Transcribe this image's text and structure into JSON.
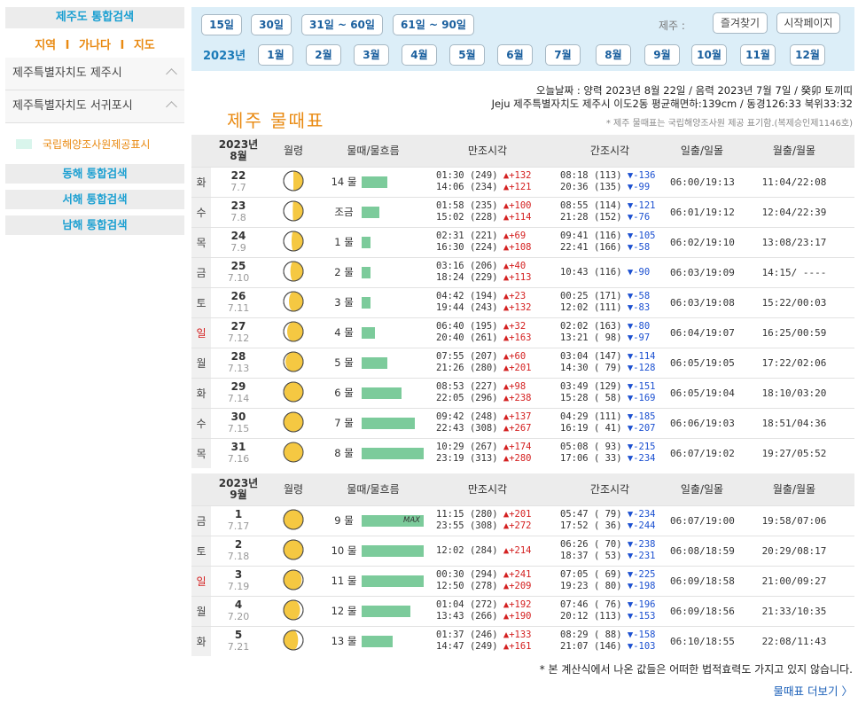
{
  "sidebar": {
    "title": "제주도 통합검색",
    "tabs": [
      "지역",
      "가나다",
      "지도"
    ],
    "tab_sep": "I",
    "regions": [
      "제주특별자치도 제주시",
      "제주특별자치도 서귀포시"
    ],
    "legend": "국립해양조사원제공표시",
    "buttons": [
      "동해 통합검색",
      "서해 통합검색",
      "남해 통합검색"
    ]
  },
  "nav": {
    "ranges": [
      "15일",
      "30일",
      "31일 ~ 60일",
      "61일 ~ 90일"
    ],
    "region_label": "제주 :",
    "favorites": "즐겨찾기",
    "home": "시작페이지",
    "year": "2023년",
    "months": [
      "1월",
      "2월",
      "3월",
      "4월",
      "5월",
      "6월",
      "7월",
      "8월",
      "9월",
      "10월",
      "11월",
      "12월"
    ]
  },
  "info": {
    "today": "오늘날짜 : 양력 2023년 8월 22일 / 음력 2023년 7월 7일 / 癸卯 토끼띠",
    "location": "Jeju 제주특별자치도 제주시 이도2동 평균해면하:139cm / 동경126:33 북위33:32",
    "title": "제주 물때표",
    "provider_note": "* 제주 물때표는 국립해양조사원 제공 표기함.(복제승인제1146호)"
  },
  "headers": {
    "moon": "월령",
    "tide": "물때/물흐름",
    "high": "만조시각",
    "low": "간조시각",
    "sun": "일출/일몰",
    "moonrise": "월출/월몰"
  },
  "months": [
    {
      "year": "2023년",
      "month": "8월",
      "rows": [
        {
          "dow": "화",
          "sun": false,
          "day": "22",
          "lunar": "7.7",
          "phase": 0.5,
          "mul": "14 물",
          "flow": 0.42,
          "max": false,
          "high": [
            {
              "t": "01:30",
              "h": "(249)",
              "d": "▲+132"
            },
            {
              "t": "14:06",
              "h": "(234)",
              "d": "▲+121"
            }
          ],
          "low": [
            {
              "t": "08:18",
              "h": "(113)",
              "d": "▼-136"
            },
            {
              "t": "20:36",
              "h": "(135)",
              "d": "▼-99"
            }
          ],
          "sun_times": "06:00/19:13",
          "moon_times": "11:04/22:08"
        },
        {
          "dow": "수",
          "sun": false,
          "day": "23",
          "lunar": "7.8",
          "phase": 0.52,
          "mul": "조금",
          "flow": 0.28,
          "max": false,
          "high": [
            {
              "t": "01:58",
              "h": "(235)",
              "d": "▲+100"
            },
            {
              "t": "15:02",
              "h": "(228)",
              "d": "▲+114"
            }
          ],
          "low": [
            {
              "t": "08:55",
              "h": "(114)",
              "d": "▼-121"
            },
            {
              "t": "21:28",
              "h": "(152)",
              "d": "▼-76"
            }
          ],
          "sun_times": "06:01/19:12",
          "moon_times": "12:04/22:39"
        },
        {
          "dow": "목",
          "sun": false,
          "day": "24",
          "lunar": "7.9",
          "phase": 0.56,
          "mul": "1 물",
          "flow": 0.14,
          "max": false,
          "high": [
            {
              "t": "02:31",
              "h": "(221)",
              "d": "▲+69"
            },
            {
              "t": "16:30",
              "h": "(224)",
              "d": "▲+108"
            }
          ],
          "low": [
            {
              "t": "09:41",
              "h": "(116)",
              "d": "▼-105"
            },
            {
              "t": "22:41",
              "h": "(166)",
              "d": "▼-58"
            }
          ],
          "sun_times": "06:02/19:10",
          "moon_times": "13:08/23:17"
        },
        {
          "dow": "금",
          "sun": false,
          "day": "25",
          "lunar": "7.10",
          "phase": 0.6,
          "mul": "2 물",
          "flow": 0.14,
          "max": false,
          "high": [
            {
              "t": "03:16",
              "h": "(206)",
              "d": "▲+40"
            },
            {
              "t": "18:24",
              "h": "(229)",
              "d": "▲+113"
            }
          ],
          "low": [
            {
              "t": "10:43",
              "h": "(116)",
              "d": "▼-90"
            }
          ],
          "sun_times": "06:03/19:09",
          "moon_times": "14:15/ ----"
        },
        {
          "dow": "토",
          "sun": false,
          "day": "26",
          "lunar": "7.11",
          "phase": 0.65,
          "mul": "3 물",
          "flow": 0.14,
          "max": false,
          "high": [
            {
              "t": "04:42",
              "h": "(194)",
              "d": "▲+23"
            },
            {
              "t": "19:44",
              "h": "(243)",
              "d": "▲+132"
            }
          ],
          "low": [
            {
              "t": "00:25",
              "h": "(171)",
              "d": "▼-58"
            },
            {
              "t": "12:02",
              "h": "(111)",
              "d": "▼-83"
            }
          ],
          "sun_times": "06:03/19:08",
          "moon_times": "15:22/00:03"
        },
        {
          "dow": "일",
          "sun": true,
          "day": "27",
          "lunar": "7.12",
          "phase": 0.72,
          "mul": "4 물",
          "flow": 0.21,
          "max": false,
          "high": [
            {
              "t": "06:40",
              "h": "(195)",
              "d": "▲+32"
            },
            {
              "t": "20:40",
              "h": "(261)",
              "d": "▲+163"
            }
          ],
          "low": [
            {
              "t": "02:02",
              "h": "(163)",
              "d": "▼-80"
            },
            {
              "t": "13:21",
              "h": "( 98)",
              "d": "▼-97"
            }
          ],
          "sun_times": "06:04/19:07",
          "moon_times": "16:25/00:59"
        },
        {
          "dow": "월",
          "sun": false,
          "day": "28",
          "lunar": "7.13",
          "phase": 0.8,
          "mul": "5 물",
          "flow": 0.42,
          "max": false,
          "high": [
            {
              "t": "07:55",
              "h": "(207)",
              "d": "▲+60"
            },
            {
              "t": "21:26",
              "h": "(280)",
              "d": "▲+201"
            }
          ],
          "low": [
            {
              "t": "03:04",
              "h": "(147)",
              "d": "▼-114"
            },
            {
              "t": "14:30",
              "h": "( 79)",
              "d": "▼-128"
            }
          ],
          "sun_times": "06:05/19:05",
          "moon_times": "17:22/02:06"
        },
        {
          "dow": "화",
          "sun": false,
          "day": "29",
          "lunar": "7.14",
          "phase": 0.88,
          "mul": "6 물",
          "flow": 0.64,
          "max": false,
          "high": [
            {
              "t": "08:53",
              "h": "(227)",
              "d": "▲+98"
            },
            {
              "t": "22:05",
              "h": "(296)",
              "d": "▲+238"
            }
          ],
          "low": [
            {
              "t": "03:49",
              "h": "(129)",
              "d": "▼-151"
            },
            {
              "t": "15:28",
              "h": "( 58)",
              "d": "▼-169"
            }
          ],
          "sun_times": "06:05/19:04",
          "moon_times": "18:10/03:20"
        },
        {
          "dow": "수",
          "sun": false,
          "day": "30",
          "lunar": "7.15",
          "phase": 0.96,
          "mul": "7 물",
          "flow": 0.85,
          "max": false,
          "high": [
            {
              "t": "09:42",
              "h": "(248)",
              "d": "▲+137"
            },
            {
              "t": "22:43",
              "h": "(308)",
              "d": "▲+267"
            }
          ],
          "low": [
            {
              "t": "04:29",
              "h": "(111)",
              "d": "▼-185"
            },
            {
              "t": "16:19",
              "h": "( 41)",
              "d": "▼-207"
            }
          ],
          "sun_times": "06:06/19:03",
          "moon_times": "18:51/04:36"
        },
        {
          "dow": "목",
          "sun": false,
          "day": "31",
          "lunar": "7.16",
          "phase": 1.0,
          "mul": "8 물",
          "flow": 1.0,
          "max": false,
          "high": [
            {
              "t": "10:29",
              "h": "(267)",
              "d": "▲+174"
            },
            {
              "t": "23:19",
              "h": "(313)",
              "d": "▲+280"
            }
          ],
          "low": [
            {
              "t": "05:08",
              "h": "( 93)",
              "d": "▼-215"
            },
            {
              "t": "17:06",
              "h": "( 33)",
              "d": "▼-234"
            }
          ],
          "sun_times": "06:07/19:02",
          "moon_times": "19:27/05:52"
        }
      ]
    },
    {
      "year": "2023년",
      "month": "9월",
      "rows": [
        {
          "dow": "금",
          "sun": false,
          "day": "1",
          "lunar": "7.17",
          "phase": 1.04,
          "mul": "9 물",
          "flow": 1.0,
          "max": true,
          "max_label": "MAX",
          "high": [
            {
              "t": "11:15",
              "h": "(280)",
              "d": "▲+201"
            },
            {
              "t": "23:55",
              "h": "(308)",
              "d": "▲+272"
            }
          ],
          "low": [
            {
              "t": "05:47",
              "h": "( 79)",
              "d": "▼-234"
            },
            {
              "t": "17:52",
              "h": "( 36)",
              "d": "▼-244"
            }
          ],
          "sun_times": "06:07/19:00",
          "moon_times": "19:58/07:06"
        },
        {
          "dow": "토",
          "sun": false,
          "day": "2",
          "lunar": "7.18",
          "phase": 1.1,
          "mul": "10 물",
          "flow": 1.0,
          "max": false,
          "high": [
            {
              "t": "12:02",
              "h": "(284)",
              "d": "▲+214"
            }
          ],
          "low": [
            {
              "t": "06:26",
              "h": "( 70)",
              "d": "▼-238"
            },
            {
              "t": "18:37",
              "h": "( 53)",
              "d": "▼-231"
            }
          ],
          "sun_times": "06:08/18:59",
          "moon_times": "20:29/08:17"
        },
        {
          "dow": "일",
          "sun": true,
          "day": "3",
          "lunar": "7.19",
          "phase": 1.18,
          "mul": "11 물",
          "flow": 1.0,
          "max": false,
          "high": [
            {
              "t": "00:30",
              "h": "(294)",
              "d": "▲+241"
            },
            {
              "t": "12:50",
              "h": "(278)",
              "d": "▲+209"
            }
          ],
          "low": [
            {
              "t": "07:05",
              "h": "( 69)",
              "d": "▼-225"
            },
            {
              "t": "19:23",
              "h": "( 80)",
              "d": "▼-198"
            }
          ],
          "sun_times": "06:09/18:58",
          "moon_times": "21:00/09:27"
        },
        {
          "dow": "월",
          "sun": false,
          "day": "4",
          "lunar": "7.20",
          "phase": 1.26,
          "mul": "12 물",
          "flow": 0.78,
          "max": false,
          "high": [
            {
              "t": "01:04",
              "h": "(272)",
              "d": "▲+192"
            },
            {
              "t": "13:43",
              "h": "(266)",
              "d": "▲+190"
            }
          ],
          "low": [
            {
              "t": "07:46",
              "h": "( 76)",
              "d": "▼-196"
            },
            {
              "t": "20:12",
              "h": "(113)",
              "d": "▼-153"
            }
          ],
          "sun_times": "06:09/18:56",
          "moon_times": "21:33/10:35"
        },
        {
          "dow": "화",
          "sun": false,
          "day": "5",
          "lunar": "7.21",
          "phase": 1.34,
          "mul": "13 물",
          "flow": 0.5,
          "max": false,
          "high": [
            {
              "t": "01:37",
              "h": "(246)",
              "d": "▲+133"
            },
            {
              "t": "14:47",
              "h": "(249)",
              "d": "▲+161"
            }
          ],
          "low": [
            {
              "t": "08:29",
              "h": "( 88)",
              "d": "▼-158"
            },
            {
              "t": "21:07",
              "h": "(146)",
              "d": "▼-103"
            }
          ],
          "sun_times": "06:10/18:55",
          "moon_times": "22:08/11:43"
        }
      ]
    }
  ],
  "footer": {
    "disclaimer": "* 본 계산식에서 나온 값들은 어떠한 법적효력도 가지고 있지 않습니다.",
    "more": "물때표 더보기",
    "more_arrow": "〉"
  },
  "colors": {
    "accent_blue": "#1a9fd1",
    "accent_orange": "#e98a12",
    "bar_green": "#7ccb9b",
    "moon_yellow": "#f5c842",
    "up_red": "#d42020",
    "down_blue": "#1a4fd0"
  }
}
